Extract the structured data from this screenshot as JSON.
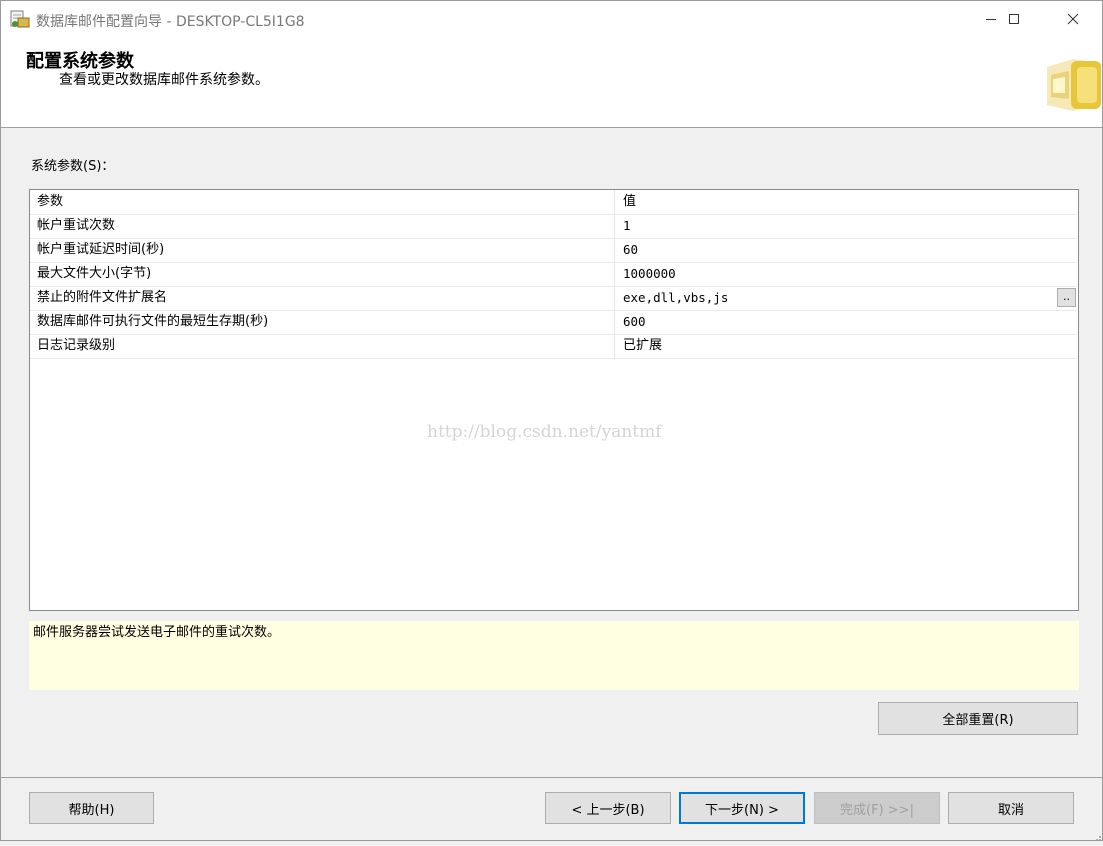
{
  "window": {
    "title": "数据库邮件配置向导 - DESKTOP-CL5I1G8",
    "minimize_glyph": "—",
    "maximize_glyph": "☐",
    "close_glyph": "✕"
  },
  "header": {
    "title": "配置系统参数",
    "subtitle": "查看或更改数据库邮件系统参数。"
  },
  "params": {
    "label": "系统参数(S)：",
    "columns": [
      "参数",
      "值"
    ],
    "rows": [
      {
        "name": "帐户重试次数",
        "value": "1"
      },
      {
        "name": "帐户重试延迟时间(秒)",
        "value": "60"
      },
      {
        "name": "最大文件大小(字节)",
        "value": "1000000"
      },
      {
        "name": "禁止的附件文件扩展名",
        "value": "exe,dll,vbs,js"
      },
      {
        "name": "数据库邮件可执行文件的最短生存期(秒)",
        "value": "600"
      },
      {
        "name": "日志记录级别",
        "value": "已扩展"
      }
    ],
    "ellipsis_label": ".."
  },
  "watermark": "http://blog.csdn.net/yantmf",
  "description": "邮件服务器尝试发送电子邮件的重试次数。",
  "buttons": {
    "reset_all": "全部重置(R)",
    "help": "帮助(H)",
    "back": "< 上一步(B)",
    "next": "下一步(N) >",
    "finish": "完成(F) >>|",
    "cancel": "取消"
  }
}
